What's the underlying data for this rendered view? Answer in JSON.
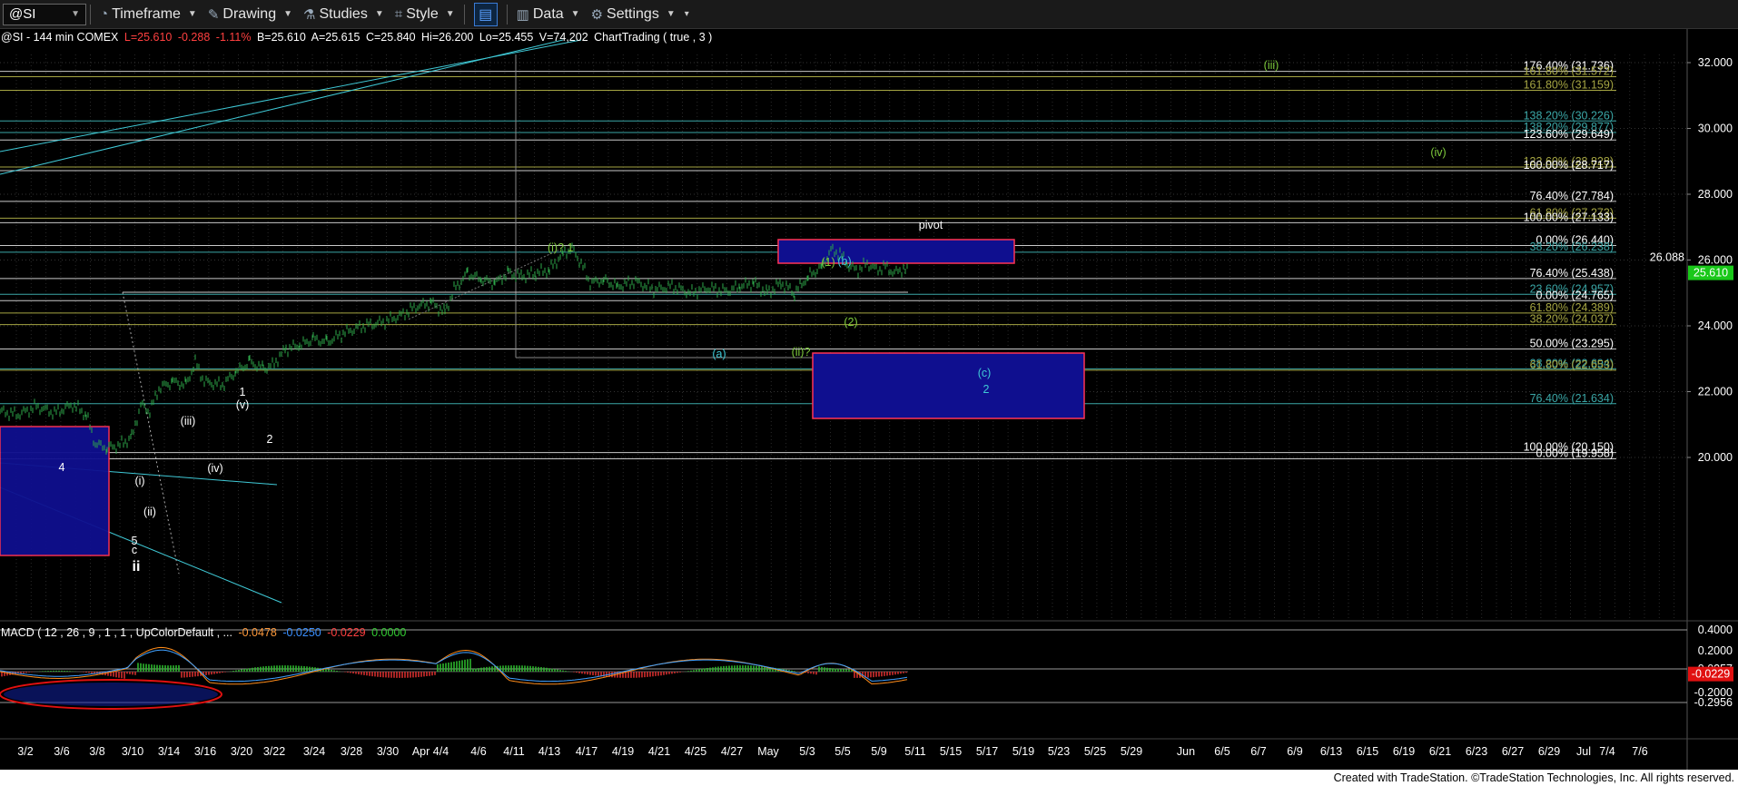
{
  "toolbar": {
    "symbol": "@SI",
    "timeframe": "Timeframe",
    "drawing": "Drawing",
    "studies": "Studies",
    "style": "Style",
    "data": "Data",
    "settings": "Settings"
  },
  "header": {
    "desc": "@SI - 144 min COMEX",
    "last": "L=25.610",
    "chg": "-0.288",
    "pct": "-1.11%",
    "bid": "B=25.610",
    "ask": "A=25.615",
    "close": "C=25.840",
    "hi": "Hi=26.200",
    "lo": "Lo=25.455",
    "vol": "V=74,202",
    "ct": "ChartTrading ( true , 3 )"
  },
  "macd_header": {
    "label": "MACD ( 12 , 26 , 9 , 1 , 1 , UpColorDefault , ...",
    "v1": "-0.0478",
    "v2": "-0.0250",
    "v3": "-0.0229",
    "v4": "0.0000"
  },
  "price_axis": [
    "32.000",
    "30.000",
    "28.000",
    "26.000",
    "24.000",
    "22.000",
    "20.000"
  ],
  "price_tags": {
    "last": "25.610",
    "line": "26.088"
  },
  "macd_axis": [
    "0.4000",
    "0.2000",
    "0.0257",
    "-0.2000",
    "-0.2956"
  ],
  "macd_tag": "-0.0229",
  "date_axis": [
    "3/2",
    "3/6",
    "3/8",
    "3/10",
    "3/14",
    "3/16",
    "3/20",
    "3/22",
    "3/24",
    "3/28",
    "3/30",
    "Apr 4/4",
    "4/6",
    "4/11",
    "4/13",
    "4/17",
    "4/19",
    "4/21",
    "4/25",
    "4/27",
    "May",
    "5/3",
    "5/5",
    "5/9",
    "5/11",
    "5/15",
    "5/17",
    "5/19",
    "5/23",
    "5/25",
    "5/29",
    "Jun",
    "6/5",
    "6/7",
    "6/9",
    "6/13",
    "6/15",
    "6/19",
    "6/21",
    "6/23",
    "6/27",
    "6/29",
    "Jul",
    "7/4",
    "7/6"
  ],
  "fib_labels": [
    "176.40% (31.736)",
    "161.80% (31.572)",
    "161.80% (31.159)",
    "138.20% (30.226)",
    "138.20% (29.877)",
    "123.60% (29.649)",
    "123.60% (28.828)",
    "100.00% (28.717)",
    "76.40% (27.784)",
    "61.80% (27.273)",
    "100.00% (27.133)",
    "0.00% (26.440)",
    "38.20% (26.238)",
    "76.40% (25.438)",
    "23.60% (24.957)",
    "0.00% (24.765)",
    "61.80% (24.389)",
    "38.20% (24.037)",
    "50.00% (23.295)",
    "38.20% (22.694)",
    "61.80% (22.653)",
    "76.40% (21.634)",
    "100.00% (20.150)",
    "0.00% (19.958)"
  ],
  "wave_labels": [
    "(iii)",
    "(iv)",
    "pivot",
    "(i)?",
    "1",
    "(1)",
    "(b)",
    "(2)",
    "(a)",
    "(ii)?",
    "(c)",
    "2",
    "1",
    "(v)",
    "(iii)",
    "(iv)",
    "2",
    "(i)",
    "(ii)",
    "4",
    "5",
    "c",
    "ii"
  ],
  "footer": "Created with TradeStation. ©TradeStation Technologies, Inc. All rights reserved.",
  "colors": {
    "price_bar": "#2ea84a",
    "fib_white": "#c8c8c8",
    "fib_teal": "#3aa6a6",
    "fib_olive": "#a5a542",
    "box_fill": "#0f0f8f",
    "box_border": "#ff3355",
    "last_tag": "#19c819",
    "macd_tag": "#e01010"
  }
}
